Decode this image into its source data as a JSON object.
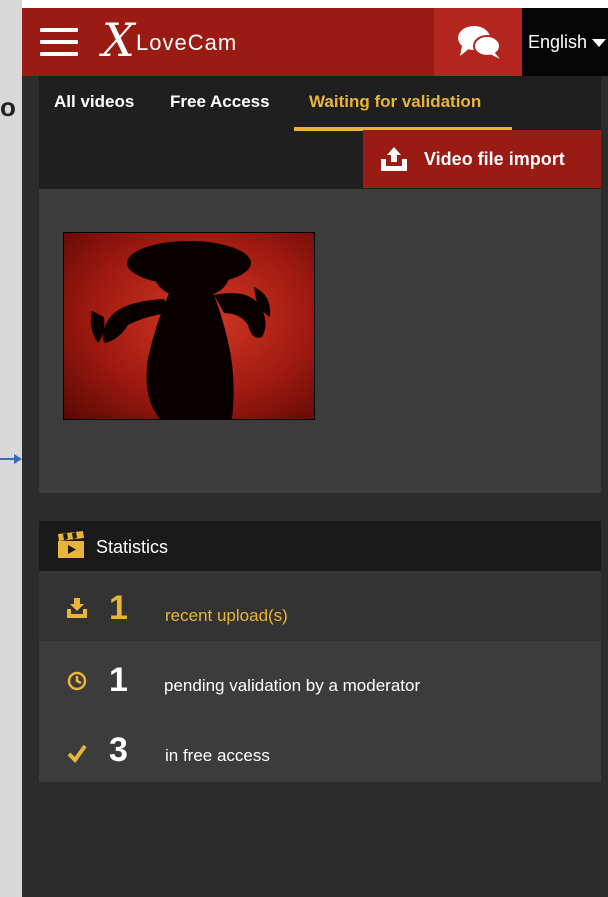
{
  "gutter": {
    "cut_text": "o"
  },
  "header": {
    "logo_x": "X",
    "logo_text": "LoveCam",
    "language": "English",
    "icons": {
      "menu": "hamburger-icon",
      "chat": "chat-bubbles-icon",
      "caret": "caret-down-icon"
    }
  },
  "tabs": [
    {
      "label": "All videos",
      "active": false
    },
    {
      "label": "Free Access",
      "active": false
    },
    {
      "label": "Waiting for validation",
      "active": true
    }
  ],
  "import_button": {
    "label": "Video file import",
    "icon": "upload-icon"
  },
  "video": {
    "thumbnail": "silhouette-woman-hat"
  },
  "statistics": {
    "title": "Statistics",
    "icon": "clapperboard-icon",
    "rows": [
      {
        "icon": "download-icon",
        "number": "1",
        "label": "recent upload(s)"
      },
      {
        "icon": "clock-icon",
        "number": "1",
        "label": "pending validation by a moderator"
      },
      {
        "icon": "checkmark-icon",
        "number": "3",
        "label": "in free access"
      }
    ]
  },
  "colors": {
    "brand_red": "#9a1a14",
    "accent_gold": "#e9b43a",
    "background": "#2c2c2c"
  }
}
